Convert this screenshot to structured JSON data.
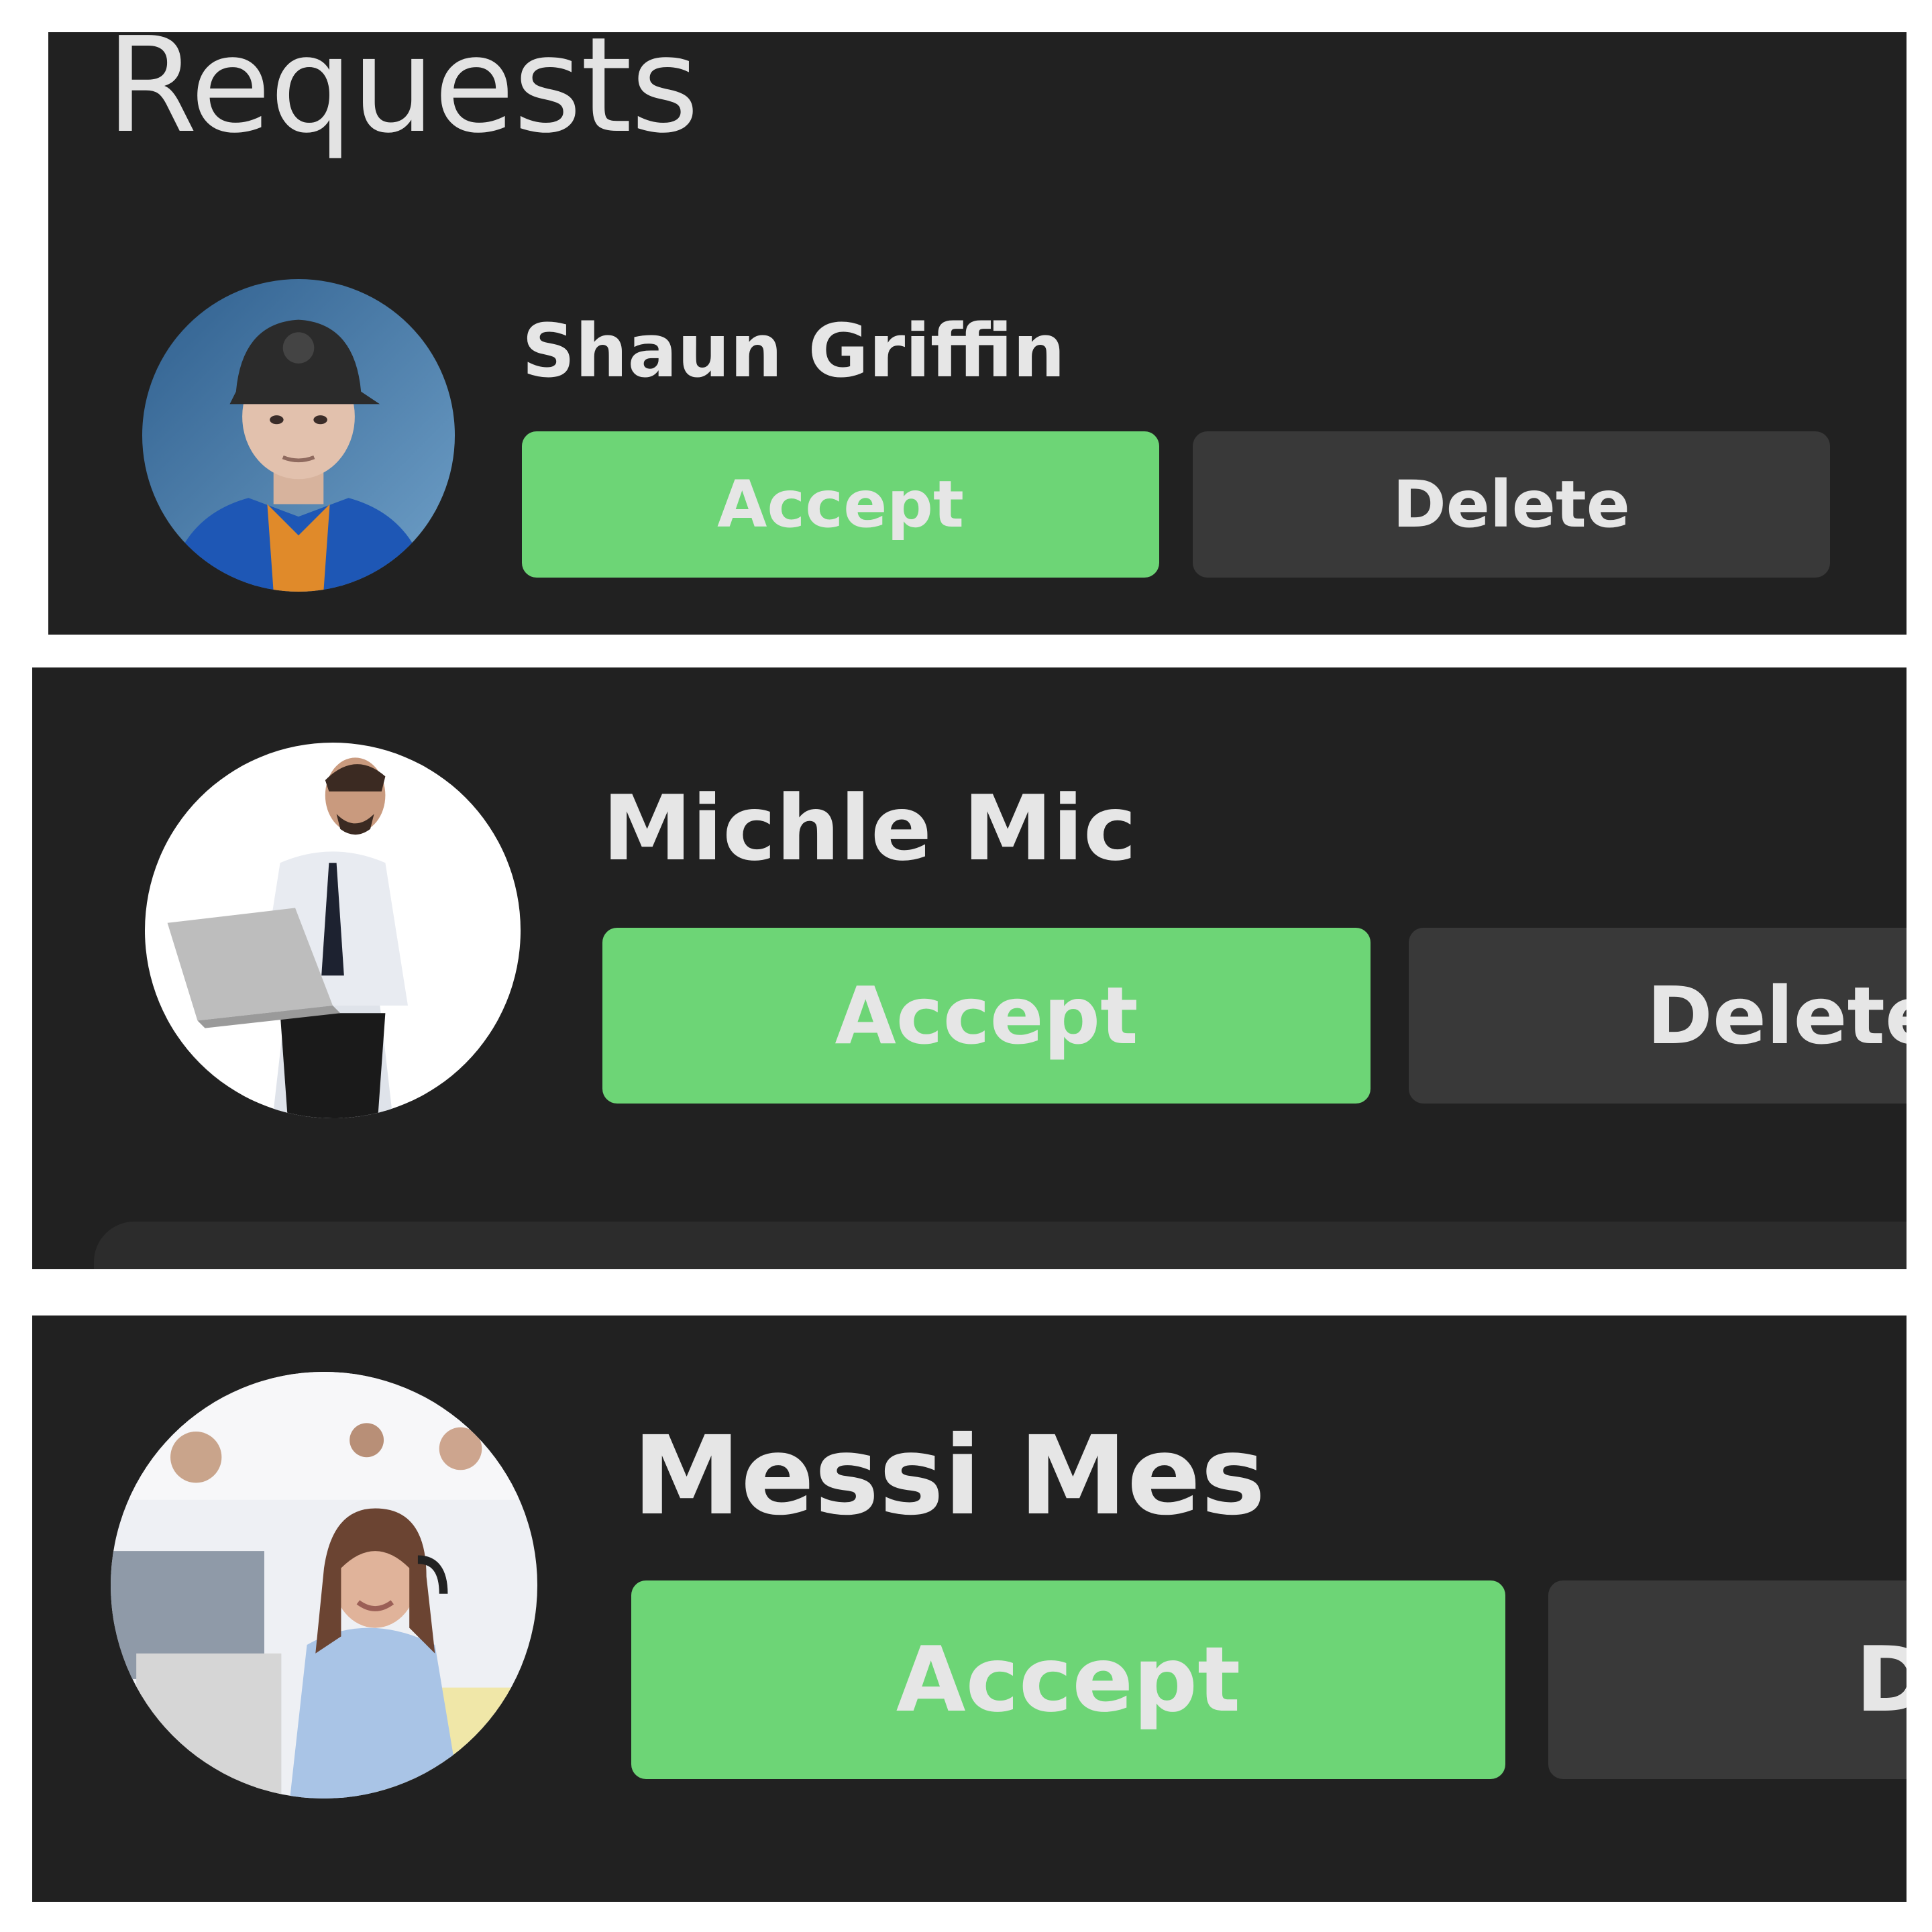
{
  "header": {
    "title": "Requests"
  },
  "requests": [
    {
      "name": "Shaun Griffin",
      "accept_label": "Accept",
      "delete_label": "Delete"
    },
    {
      "name": "Michle Mic",
      "accept_label": "Accept",
      "delete_label": "Delete"
    },
    {
      "name": "Messi Mes",
      "accept_label": "Accept",
      "delete_label": "Delete"
    }
  ],
  "colors": {
    "background": "#212121",
    "accept": "#6dd576",
    "delete": "#393939",
    "text": "#e6e6e6"
  }
}
